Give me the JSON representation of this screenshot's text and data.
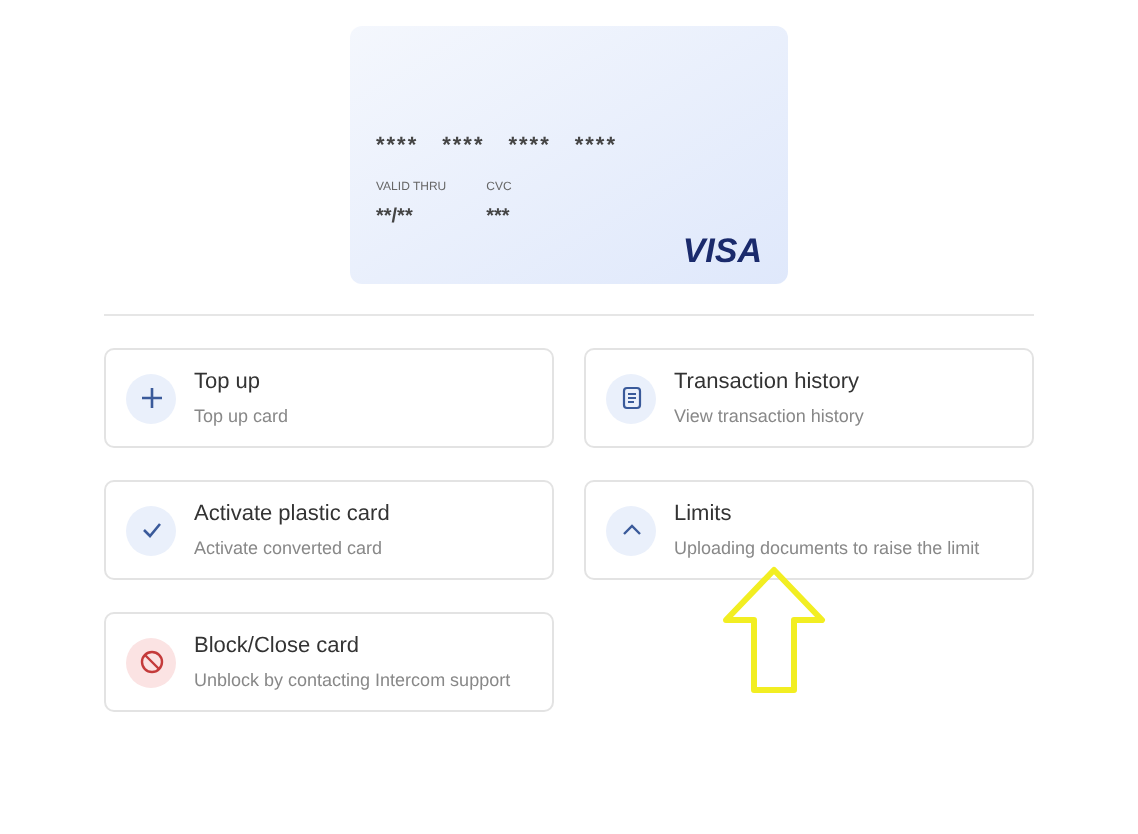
{
  "card": {
    "number_groups": [
      "****",
      "****",
      "****",
      "****"
    ],
    "valid_thru_label": "VALID THRU",
    "valid_thru": "**/**",
    "cvc_label": "CVC",
    "cvc": "***",
    "brand": "VISA"
  },
  "actions": [
    {
      "kind": "plus",
      "title": "Top up",
      "subtitle": "Top up card"
    },
    {
      "kind": "document",
      "title": "Transaction history",
      "subtitle": "View transaction history"
    },
    {
      "kind": "check",
      "title": "Activate plastic card",
      "subtitle": "Activate converted card"
    },
    {
      "kind": "chevron",
      "title": "Limits",
      "subtitle": "Uploading documents to raise the limit"
    },
    {
      "kind": "block",
      "title": "Block/Close card",
      "subtitle": "Unblock by contacting Intercom support"
    }
  ]
}
